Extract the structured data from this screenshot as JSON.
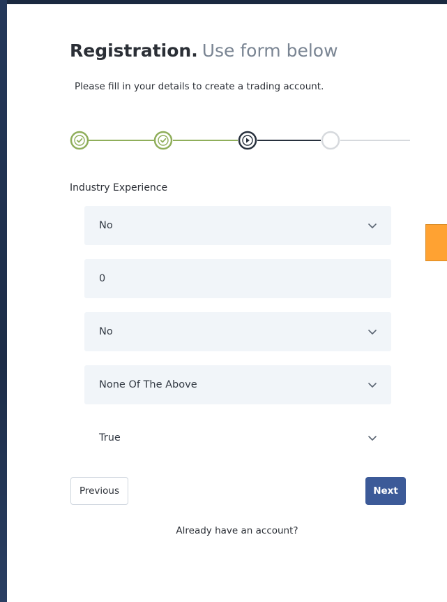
{
  "header": {
    "title_bold": "Registration.",
    "title_light": "Use form below",
    "subtitle": "Please fill in your details to create a trading account."
  },
  "stepper": {
    "steps": [
      {
        "state": "completed",
        "icon": "check-icon"
      },
      {
        "state": "completed",
        "icon": "check-icon"
      },
      {
        "state": "current",
        "icon": "play-icon"
      },
      {
        "state": "upcoming",
        "icon": "empty-circle-icon"
      }
    ],
    "colors": {
      "completed": "#8fae5a",
      "current": "#27303d",
      "upcoming": "#d6d9dd"
    }
  },
  "section": {
    "label": "Industry Experience"
  },
  "fields": [
    {
      "value": "No",
      "type": "select",
      "icon": "chevron-down-icon"
    },
    {
      "value": "0",
      "type": "text"
    },
    {
      "value": "No",
      "type": "select",
      "icon": "chevron-down-icon"
    },
    {
      "value": "None Of The Above",
      "type": "select",
      "icon": "chevron-down-icon"
    },
    {
      "value": "True",
      "type": "select",
      "icon": "chevron-down-icon"
    }
  ],
  "actions": {
    "previous_label": "Previous",
    "next_label": "Next"
  },
  "footer": {
    "login_link": "Already have an account?"
  },
  "colors": {
    "accent": "#3c5a98",
    "field_bg": "#f1f5f9",
    "side_tab": "#ffa232",
    "background": "#1e2f4a"
  }
}
